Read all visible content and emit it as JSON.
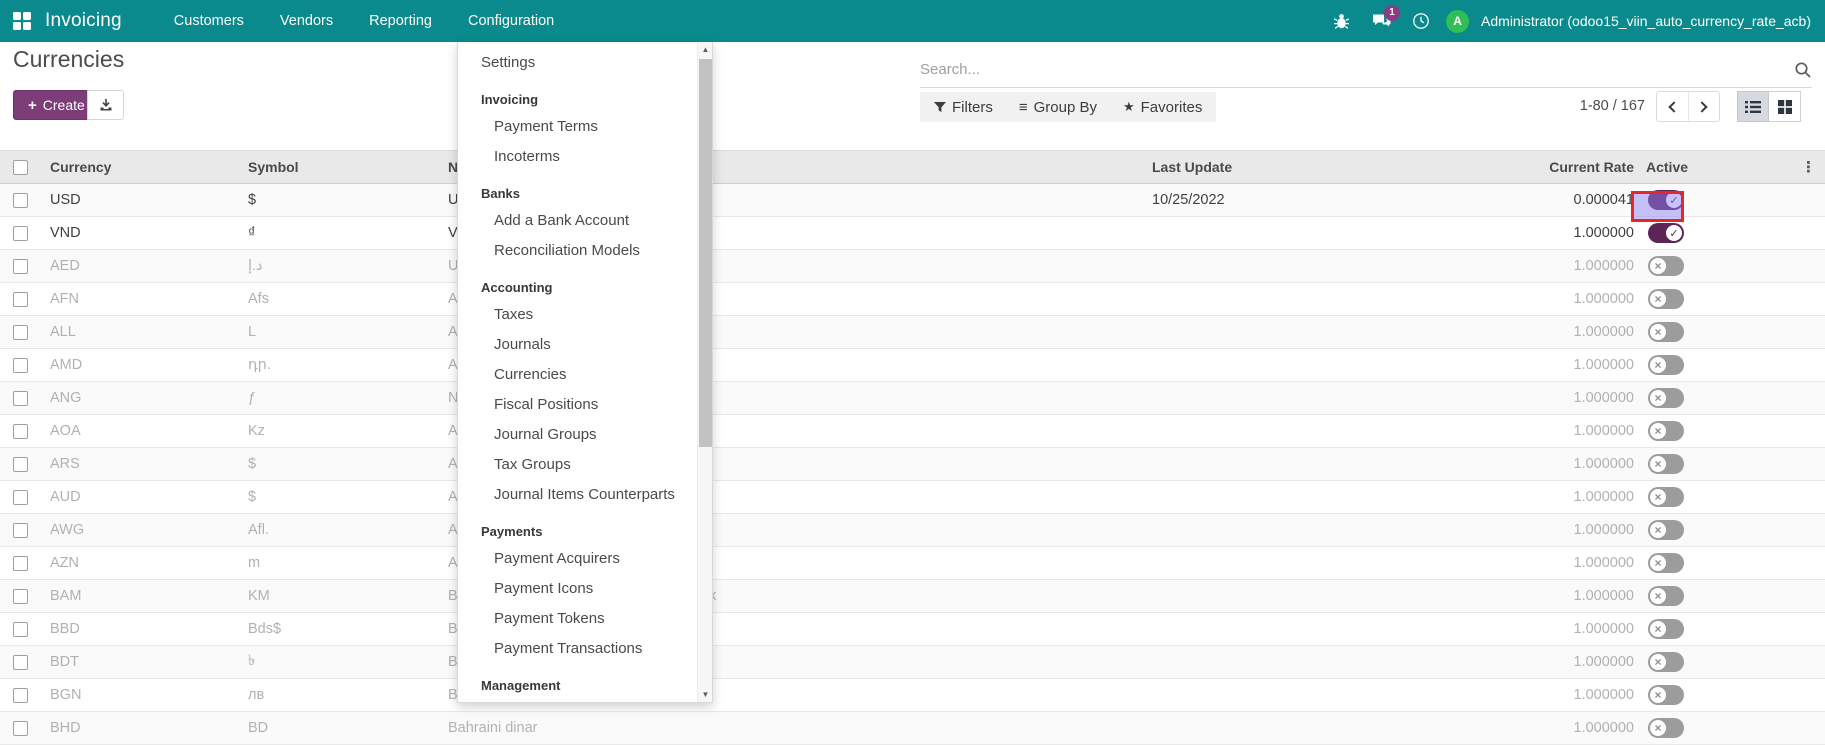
{
  "navbar": {
    "app_name": "Invoicing",
    "menu_items": [
      {
        "label": "Customers"
      },
      {
        "label": "Vendors"
      },
      {
        "label": "Reporting"
      },
      {
        "label": "Configuration"
      }
    ],
    "message_badge": "1",
    "avatar_initial": "A",
    "user_label": "Administrator (odoo15_viin_auto_currency_rate_acb)"
  },
  "control_panel": {
    "title": "Currencies",
    "create_label": "Create",
    "search_placeholder": "Search...",
    "filters_label": "Filters",
    "group_by_label": "Group By",
    "favorites_label": "Favorites",
    "pager_range": "1-80 / 167"
  },
  "config_menu": {
    "sections": [
      {
        "header": "",
        "items": [
          "Settings"
        ]
      },
      {
        "header": "Invoicing",
        "items": [
          "Payment Terms",
          "Incoterms"
        ]
      },
      {
        "header": "Banks",
        "items": [
          "Add a Bank Account",
          "Reconciliation Models"
        ]
      },
      {
        "header": "Accounting",
        "items": [
          "Taxes",
          "Journals",
          "Currencies",
          "Fiscal Positions",
          "Journal Groups",
          "Tax Groups",
          "Journal Items Counterparts"
        ]
      },
      {
        "header": "Payments",
        "items": [
          "Payment Acquirers",
          "Payment Icons",
          "Payment Tokens",
          "Payment Transactions"
        ]
      },
      {
        "header": "Management",
        "items": []
      }
    ]
  },
  "table": {
    "columns": {
      "currency": "Currency",
      "symbol": "Symbol",
      "name": "Name",
      "last_update": "Last Update",
      "current_rate": "Current Rate",
      "active": "Active"
    },
    "rows": [
      {
        "code": "USD",
        "symbol": "$",
        "name": "United States dollar",
        "last_update": "10/25/2022",
        "rate": "0.000041",
        "active": true,
        "highlighted": true
      },
      {
        "code": "VND",
        "symbol": "₫",
        "name": "Vietnamese đồng",
        "last_update": "",
        "rate": "1.000000",
        "active": true,
        "highlighted": false
      },
      {
        "code": "AED",
        "symbol": "د.إ",
        "name": "United Arab Emirates dirham",
        "last_update": "",
        "rate": "1.000000",
        "active": false,
        "highlighted": false
      },
      {
        "code": "AFN",
        "symbol": "Afs",
        "name": "Afghan afghani",
        "last_update": "",
        "rate": "1.000000",
        "active": false,
        "highlighted": false
      },
      {
        "code": "ALL",
        "symbol": "L",
        "name": "Albanian lek",
        "last_update": "",
        "rate": "1.000000",
        "active": false,
        "highlighted": false
      },
      {
        "code": "AMD",
        "symbol": "դր.",
        "name": "Armenian dram",
        "last_update": "",
        "rate": "1.000000",
        "active": false,
        "highlighted": false
      },
      {
        "code": "ANG",
        "symbol": "ƒ",
        "name": "Netherlands Antillean guilder",
        "last_update": "",
        "rate": "1.000000",
        "active": false,
        "highlighted": false
      },
      {
        "code": "AOA",
        "symbol": "Kz",
        "name": "Angolan kwanza",
        "last_update": "",
        "rate": "1.000000",
        "active": false,
        "highlighted": false
      },
      {
        "code": "ARS",
        "symbol": "$",
        "name": "Argentine peso",
        "last_update": "",
        "rate": "1.000000",
        "active": false,
        "highlighted": false
      },
      {
        "code": "AUD",
        "symbol": "$",
        "name": "Australian dollar",
        "last_update": "",
        "rate": "1.000000",
        "active": false,
        "highlighted": false
      },
      {
        "code": "AWG",
        "symbol": "Afl.",
        "name": "Aruban florin",
        "last_update": "",
        "rate": "1.000000",
        "active": false,
        "highlighted": false
      },
      {
        "code": "AZN",
        "symbol": "m",
        "name": "Azerbaijani manat",
        "last_update": "",
        "rate": "1.000000",
        "active": false,
        "highlighted": false
      },
      {
        "code": "BAM",
        "symbol": "KM",
        "name": "Bosnia and Herzegovina convertible mark",
        "last_update": "",
        "rate": "1.000000",
        "active": false,
        "highlighted": false
      },
      {
        "code": "BBD",
        "symbol": "Bds$",
        "name": "Barbadian dollar",
        "last_update": "",
        "rate": "1.000000",
        "active": false,
        "highlighted": false
      },
      {
        "code": "BDT",
        "symbol": "৳",
        "name": "Bangladeshi taka",
        "last_update": "",
        "rate": "1.000000",
        "active": false,
        "highlighted": false
      },
      {
        "code": "BGN",
        "symbol": "лв",
        "name": "Bulgarian lev",
        "last_update": "",
        "rate": "1.000000",
        "active": false,
        "highlighted": false
      },
      {
        "code": "BHD",
        "symbol": "BD",
        "name": "Bahraini dinar",
        "last_update": "",
        "rate": "1.000000",
        "active": false,
        "highlighted": false
      }
    ]
  },
  "colors": {
    "navbar": "#0a8a8c",
    "primary_button": "#7d3d78",
    "toggle_active": "#5c2558",
    "toggle_inactive": "#9c9c9c",
    "highlight_border": "#e7252b",
    "highlight_fill": "#8c80f4",
    "badge": "#8f3a84",
    "avatar": "#2fbf55"
  }
}
